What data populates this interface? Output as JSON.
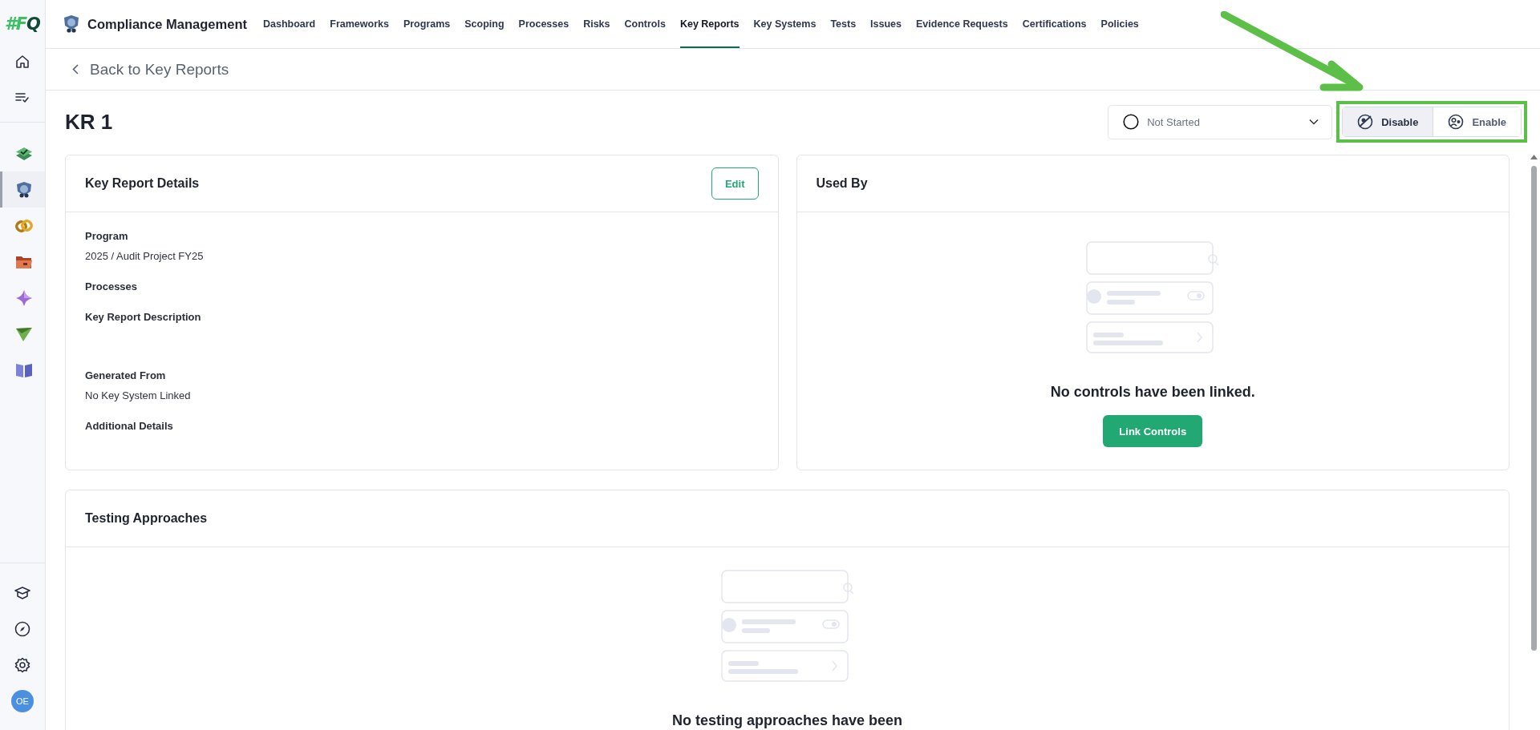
{
  "sidebar": {
    "logo": "#FQ",
    "apps": [
      {
        "kind": "layers",
        "selected": false
      },
      {
        "kind": "shield",
        "selected": true
      },
      {
        "kind": "rings",
        "selected": false
      },
      {
        "kind": "folder",
        "selected": false
      },
      {
        "kind": "sparkle",
        "selected": false
      },
      {
        "kind": "plane",
        "selected": false
      },
      {
        "kind": "book",
        "selected": false
      }
    ],
    "user": {
      "initials": "OE"
    }
  },
  "header": {
    "title": "Compliance Management",
    "nav": [
      {
        "label": "Dashboard",
        "selected": false
      },
      {
        "label": "Frameworks",
        "selected": false
      },
      {
        "label": "Programs",
        "selected": false
      },
      {
        "label": "Scoping",
        "selected": false
      },
      {
        "label": "Processes",
        "selected": false
      },
      {
        "label": "Risks",
        "selected": false
      },
      {
        "label": "Controls",
        "selected": false
      },
      {
        "label": "Key Reports",
        "selected": true
      },
      {
        "label": "Key Systems",
        "selected": false
      },
      {
        "label": "Tests",
        "selected": false
      },
      {
        "label": "Issues",
        "selected": false
      },
      {
        "label": "Evidence Requests",
        "selected": false
      },
      {
        "label": "Certifications",
        "selected": false
      },
      {
        "label": "Policies",
        "selected": false
      }
    ]
  },
  "back_link": "Back to Key Reports",
  "page_title": "KR 1",
  "status": {
    "value": "Not Started"
  },
  "toggle": [
    {
      "kind": "disable",
      "label": "Disable",
      "selected": true
    },
    {
      "kind": "enable",
      "label": "Enable",
      "selected": false
    }
  ],
  "details": {
    "title": "Key Report Details",
    "edit": "Edit",
    "fields": [
      {
        "kind": "line",
        "label": "Program",
        "value": "2025 / Audit Project FY25"
      },
      {
        "kind": "line",
        "label": "Processes"
      },
      {
        "kind": "area",
        "label": "Key Report Description"
      },
      {
        "kind": "line",
        "label": "Generated From",
        "value": "No Key System Linked"
      },
      {
        "kind": "line",
        "label": "Additional Details"
      }
    ]
  },
  "used_by": {
    "title": "Used By",
    "empty_message": "No controls have been linked.",
    "button": "Link Controls"
  },
  "testing": {
    "title": "Testing Approaches",
    "empty_message": "No testing approaches have been"
  }
}
